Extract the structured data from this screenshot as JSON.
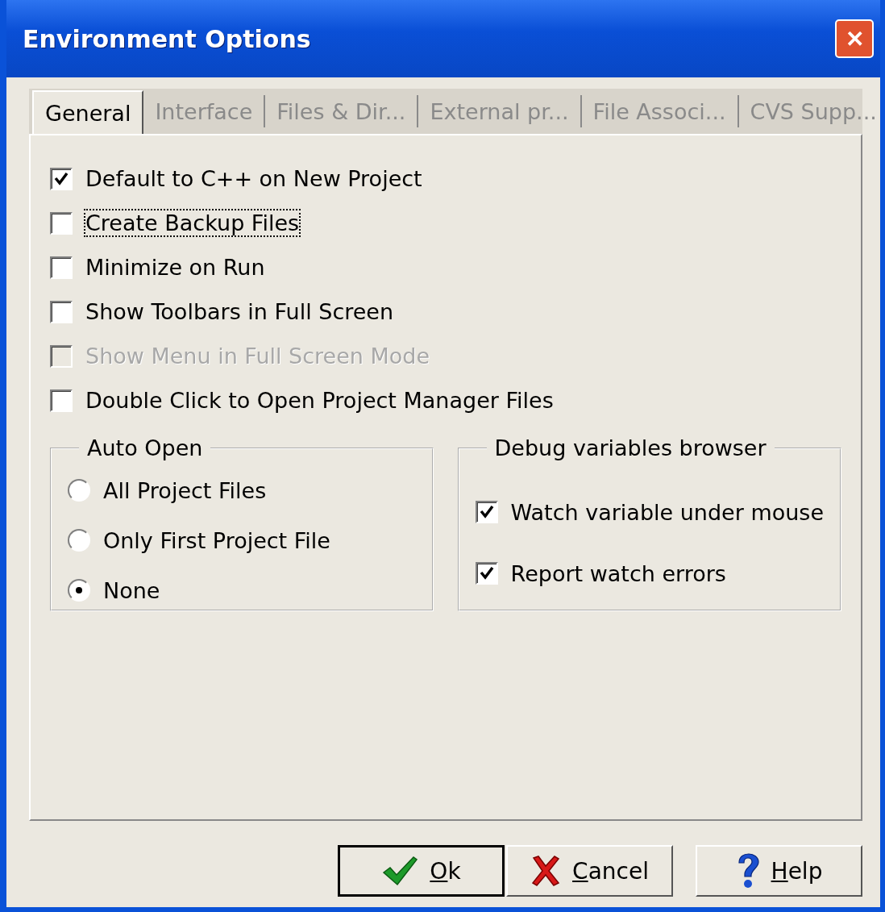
{
  "window": {
    "title": "Environment Options",
    "close": "✕"
  },
  "tabs": [
    {
      "label": "General",
      "selected": true
    },
    {
      "label": "Interface",
      "selected": false
    },
    {
      "label": "Files & Dir...",
      "selected": false
    },
    {
      "label": "External pr...",
      "selected": false
    },
    {
      "label": "File Associ...",
      "selected": false
    },
    {
      "label": "CVS Supp...",
      "selected": false
    }
  ],
  "options": [
    {
      "label": "Default to C++ on New Project",
      "checked": true,
      "disabled": false,
      "focused": false
    },
    {
      "label": "Create Backup Files",
      "checked": false,
      "disabled": false,
      "focused": true
    },
    {
      "label": "Minimize on Run",
      "checked": false,
      "disabled": false,
      "focused": false
    },
    {
      "label": "Show Toolbars in Full Screen",
      "checked": false,
      "disabled": false,
      "focused": false
    },
    {
      "label": "Show Menu in Full Screen Mode",
      "checked": false,
      "disabled": true,
      "focused": false
    },
    {
      "label": "Double Click to Open Project Manager Files",
      "checked": false,
      "disabled": false,
      "focused": false
    }
  ],
  "auto_open": {
    "title": "Auto Open",
    "options": [
      {
        "label": "All Project Files",
        "selected": false
      },
      {
        "label": "Only First Project File",
        "selected": false
      },
      {
        "label": "None",
        "selected": true
      }
    ]
  },
  "debug_browser": {
    "title": "Debug variables browser",
    "options": [
      {
        "label": "Watch variable under mouse",
        "checked": true
      },
      {
        "label": "Report watch errors",
        "checked": true
      }
    ]
  },
  "buttons": [
    {
      "label": "Ok",
      "kind": "ok",
      "default": true
    },
    {
      "label": "Cancel",
      "kind": "cancel",
      "default": false
    },
    {
      "label": "Help",
      "kind": "help",
      "default": false
    }
  ]
}
